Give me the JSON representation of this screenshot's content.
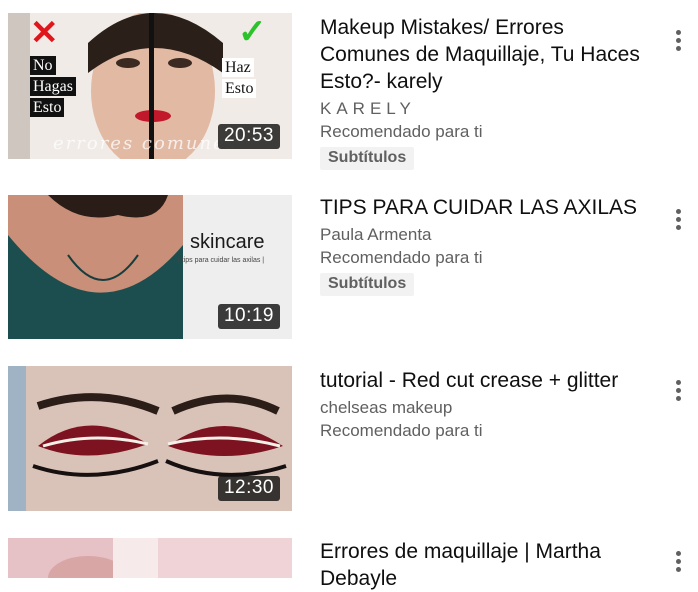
{
  "videos": [
    {
      "title": "Makeup Mistakes/ Errores Comunes de Maquillaje, Tu Haces Esto?- karely",
      "channel": "KARELY",
      "reason": "Recomendado para ti",
      "badge": "Subtítulos",
      "duration": "20:53",
      "thumb_text": {
        "no": "No",
        "hagas": "Hagas",
        "esto_left": "Esto",
        "haz": "Haz",
        "esto_right": "Esto",
        "script": "errores comunes"
      },
      "thumb_icons": [
        "red-x-icon",
        "green-check-icon"
      ]
    },
    {
      "title": "TIPS PARA CUIDAR LAS AXILAS",
      "channel": "Paula Armenta",
      "reason": "Recomendado para ti",
      "badge": "Subtítulos",
      "duration": "10:19",
      "thumb_text": {
        "brand": "skincare",
        "sub": "| tips para cuidar las axilas |"
      }
    },
    {
      "title": "tutorial - Red cut crease + glitter",
      "channel": "chelseas makeup",
      "reason": "Recomendado para ti",
      "duration": "12:30"
    },
    {
      "title": "Errores de maquillaje | Martha Debayle"
    }
  ],
  "colors": {
    "text": "#0f0f0f",
    "secondary": "#606060",
    "badge_bg": "#f2f2f2",
    "duration_bg": "#141414"
  }
}
